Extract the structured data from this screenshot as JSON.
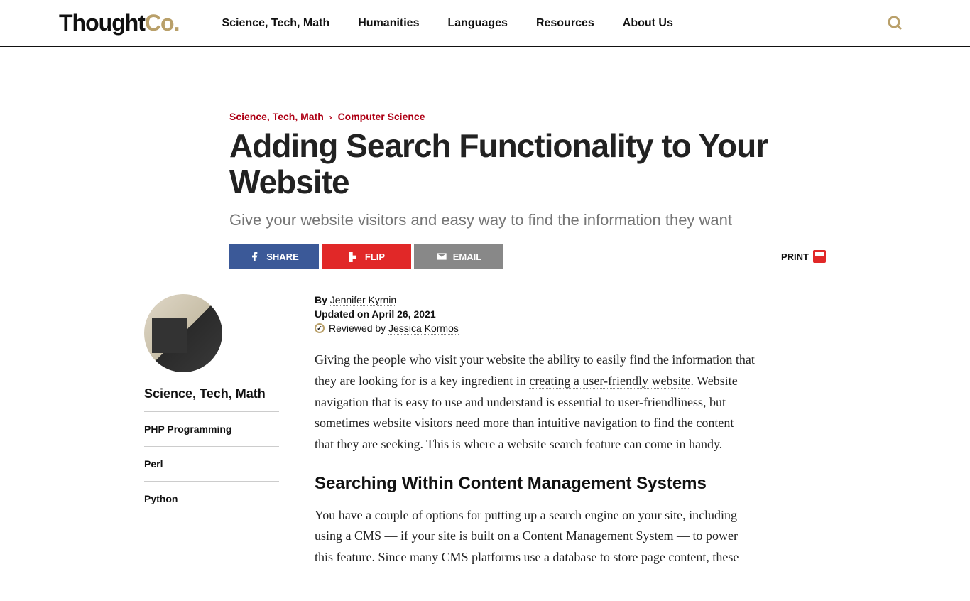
{
  "header": {
    "logo_thought": "Thought",
    "logo_co": "Co",
    "logo_dot": ".",
    "nav": [
      "Science, Tech, Math",
      "Humanities",
      "Languages",
      "Resources",
      "About Us"
    ]
  },
  "breadcrumb": {
    "item1": "Science, Tech, Math",
    "sep": "›",
    "item2": "Computer Science"
  },
  "article": {
    "title": "Adding Search Functionality to Your Website",
    "subtitle": "Give your website visitors and easy way to find the information they want",
    "share_fb": "SHARE",
    "share_flip": "FLIP",
    "share_email": "EMAIL",
    "print": "PRINT",
    "by_prefix": "By ",
    "author": "Jennifer Kyrnin",
    "updated": "Updated on April 26, 2021",
    "reviewed_prefix": "Reviewed by ",
    "reviewer": "Jessica Kormos",
    "p1_a": "Giving the people who visit your website the ability to easily find the information that they are looking for is a key ingredient in ",
    "p1_link": "creating a user-friendly website",
    "p1_b": ". Website navigation that is easy to use and understand is essential to user-friendliness, but sometimes website visitors need more than intuitive navigation to find the content that they are seeking. This is where a website search feature can come in handy.",
    "h2": "Searching Within Content Management Systems",
    "p2_a": "You have a couple of options for putting up a search engine on your site, including using a CMS — if your site is built on a ",
    "p2_link": "Content Management System",
    "p2_b": " — to power this feature. Since many CMS platforms use a database to store page content, these"
  },
  "sidebar": {
    "title": "Science, Tech, Math",
    "items": [
      "PHP Programming",
      "Perl",
      "Python"
    ]
  }
}
